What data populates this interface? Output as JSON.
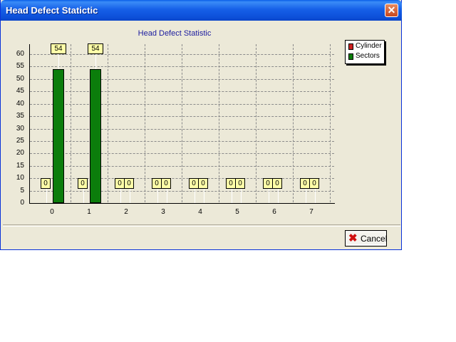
{
  "window": {
    "title": "Head Defect Statictic",
    "close_icon": "close-icon",
    "cancel_label": "Cancel",
    "cancel_icon": "red-x-icon"
  },
  "chart_data": {
    "type": "bar",
    "title": "Head Defect Statistic",
    "categories": [
      "0",
      "1",
      "2",
      "3",
      "4",
      "5",
      "6",
      "7"
    ],
    "series": [
      {
        "name": "Cylinder",
        "color": "#cc2020",
        "values": [
          0,
          0,
          0,
          0,
          0,
          0,
          0,
          0
        ]
      },
      {
        "name": "Sectors",
        "color": "#0b7d0b",
        "values": [
          54,
          54,
          0,
          0,
          0,
          0,
          0,
          0
        ]
      }
    ],
    "yticks": [
      "0",
      "5",
      "10",
      "15",
      "20",
      "25",
      "30",
      "35",
      "40",
      "45",
      "50",
      "55",
      "60"
    ],
    "ylim": [
      0,
      63
    ],
    "grid": true,
    "legend_position": "right",
    "data_labels": true
  }
}
